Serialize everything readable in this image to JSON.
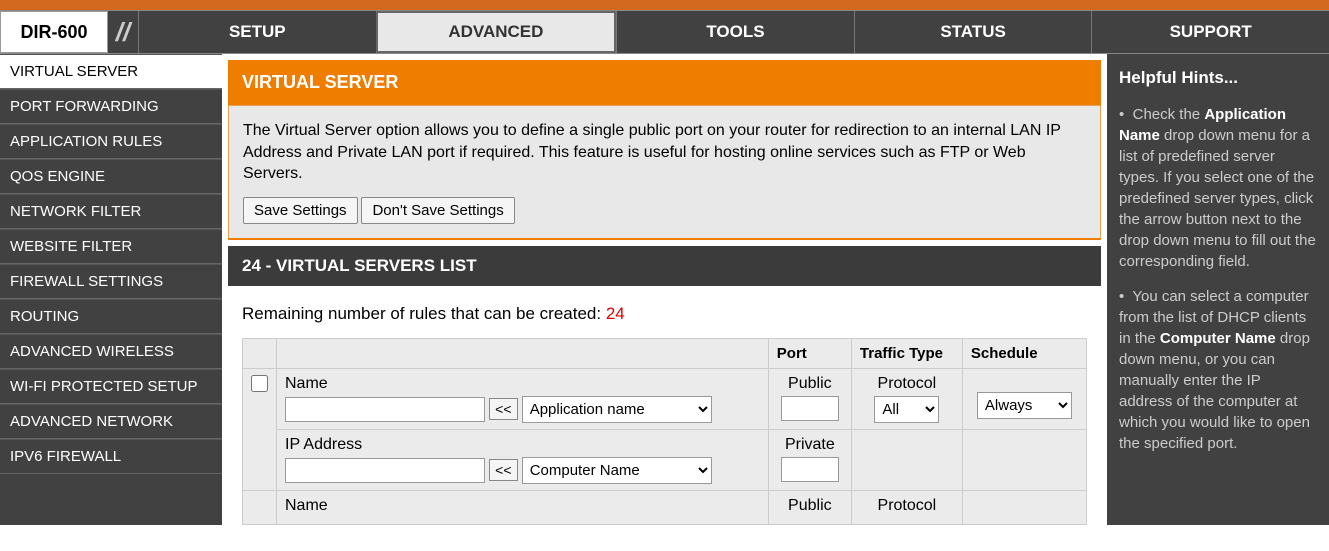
{
  "model": "DIR-600",
  "nav": {
    "setup": "SETUP",
    "advanced": "ADVANCED",
    "tools": "TOOLS",
    "status": "STATUS",
    "support": "SUPPORT"
  },
  "sidebar": {
    "items": [
      {
        "label": "VIRTUAL SERVER"
      },
      {
        "label": "PORT FORWARDING"
      },
      {
        "label": "APPLICATION RULES"
      },
      {
        "label": "QOS ENGINE"
      },
      {
        "label": "NETWORK FILTER"
      },
      {
        "label": "WEBSITE FILTER"
      },
      {
        "label": "FIREWALL SETTINGS"
      },
      {
        "label": "ROUTING"
      },
      {
        "label": "ADVANCED WIRELESS"
      },
      {
        "label": "WI-FI PROTECTED SETUP"
      },
      {
        "label": "ADVANCED NETWORK"
      },
      {
        "label": "IPV6 FIREWALL"
      }
    ]
  },
  "page": {
    "title": "VIRTUAL SERVER",
    "intro": "The Virtual Server option allows you to define a single public port on your router for redirection to an internal LAN IP Address and Private LAN port if required. This feature is useful for hosting online services such as FTP or Web Servers.",
    "save_label": "Save Settings",
    "dont_save_label": "Don't Save Settings",
    "section_header": "24 - VIRTUAL SERVERS LIST",
    "remaining_text": "Remaining number of rules that can be created: ",
    "remaining_count": "24",
    "table": {
      "hdr_port": "Port",
      "hdr_traffic": "Traffic Type",
      "hdr_schedule": "Schedule",
      "name_label": "Name",
      "ip_label": "IP Address",
      "public_label": "Public",
      "private_label": "Private",
      "protocol_label": "Protocol",
      "arrow_label": "<<",
      "app_select": "Application name",
      "comp_select": "Computer Name",
      "proto_select": "All",
      "sched_select": "Always"
    }
  },
  "hints": {
    "title": "Helpful Hints...",
    "bullet": "•",
    "p1a": "Check the ",
    "p1b": "Application Name",
    "p1c": " drop down menu for a list of predefined server types. If you select one of the predefined server types, click the arrow button next to the drop down menu to fill out the corresponding field.",
    "p2a": "You can select a computer from the list of DHCP clients in the ",
    "p2b": "Computer Name",
    "p2c": " drop down menu, or you can manually enter the IP address of the computer at which you would like to open the specified port."
  }
}
